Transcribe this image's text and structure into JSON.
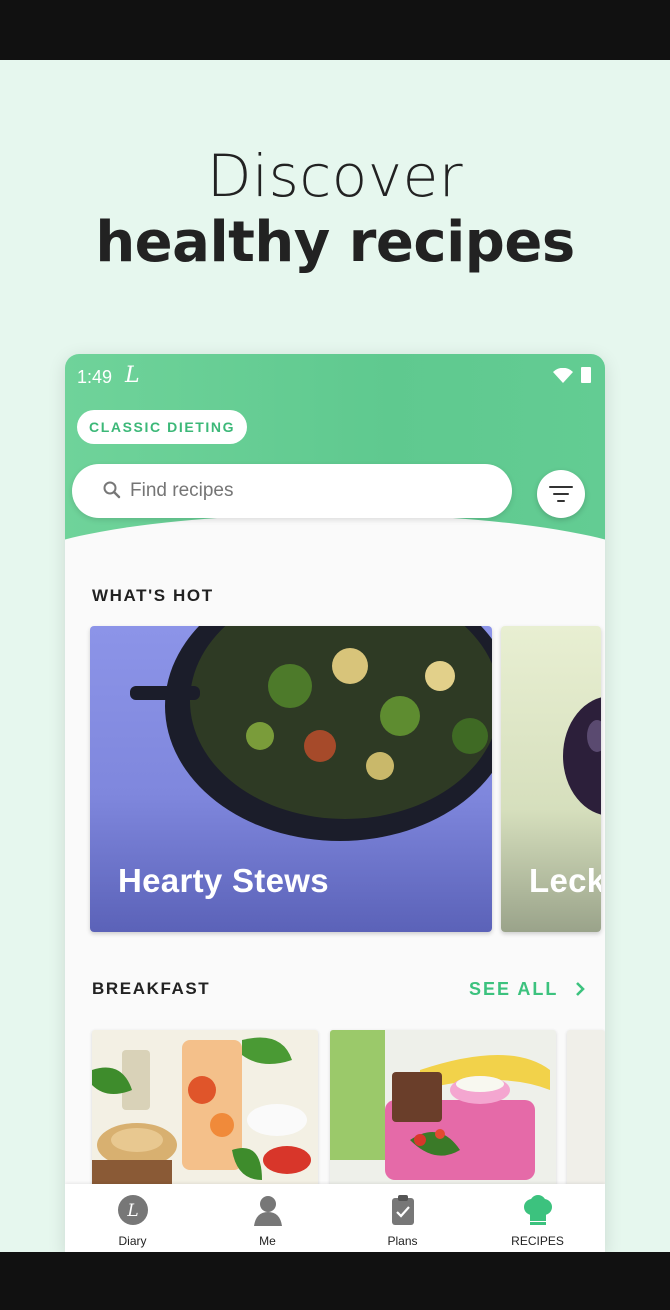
{
  "hero": {
    "line1": "Discover",
    "line2": "healthy recipes"
  },
  "status": {
    "time": "1:49",
    "app_mark": "L"
  },
  "header": {
    "diet_chip": "CLASSIC DIETING"
  },
  "search": {
    "placeholder": "Find recipes"
  },
  "sections": {
    "whats_hot": {
      "title": "WHAT'S HOT",
      "cards": [
        {
          "title": "Hearty Stews"
        },
        {
          "title": "Leck"
        }
      ]
    },
    "breakfast": {
      "title": "BREAKFAST",
      "see_all": "SEE ALL"
    }
  },
  "nav": {
    "items": [
      {
        "label": "Diary",
        "icon": "lifesum-logo-icon"
      },
      {
        "label": "Me",
        "icon": "profile-icon"
      },
      {
        "label": "Plans",
        "icon": "clipboard-icon"
      },
      {
        "label": "RECIPES",
        "icon": "chef-hat-icon",
        "active": true
      }
    ]
  },
  "colors": {
    "accent": "#3cc27e",
    "header": "#63cc93",
    "background": "#e6f7ee"
  }
}
